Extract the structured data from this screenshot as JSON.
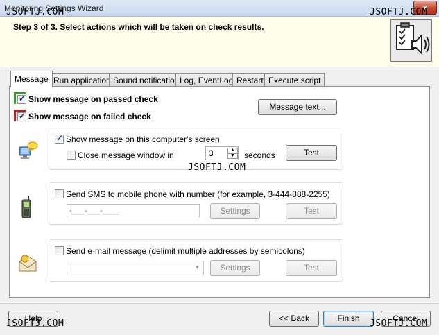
{
  "window": {
    "title": "Monitoring Settings Wizard",
    "close_glyph": "x"
  },
  "header": {
    "step_text": "Step 3 of 3. Select actions which will be taken on check results.",
    "icon": "checklist-speaker-icon"
  },
  "tabs": [
    {
      "label": "Message"
    },
    {
      "label": "Run application"
    },
    {
      "label": "Sound notification"
    },
    {
      "label": "Log, EventLog"
    },
    {
      "label": "Restart"
    },
    {
      "label": "Execute script"
    }
  ],
  "message_tab": {
    "passed_label": "Show message on passed check",
    "failed_label": "Show message on failed check",
    "message_text_button": "Message text...",
    "screen": {
      "show_label": "Show message on this computer's screen",
      "close_label": "Close message window in",
      "seconds_value": "3",
      "seconds_label": "seconds",
      "test_button": "Test"
    },
    "sms": {
      "label": "Send SMS to mobile phone with number (for example, 3-444-888-2255)",
      "phone_mask": "-___-___-____",
      "settings_button": "Settings",
      "test_button": "Test"
    },
    "email": {
      "label": "Send e-mail message (delimit multiple addresses by semicolons)",
      "settings_button": "Settings",
      "test_button": "Test"
    }
  },
  "footer": {
    "help_button": "Help",
    "back_button": "<< Back",
    "finish_button": "Finish",
    "cancel_button": "Cancel"
  },
  "watermark": "JSOFTJ.COM",
  "colors": {
    "header_bg": "#fefde9",
    "passed_accent": "#2e9b2e",
    "failed_accent": "#b22222"
  }
}
